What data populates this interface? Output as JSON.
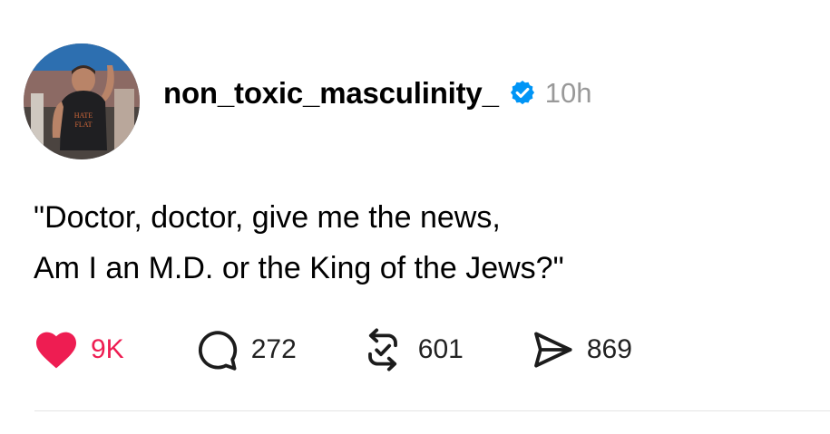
{
  "post": {
    "author": {
      "username": "non_toxic_masculinity_",
      "verified": true,
      "avatar_shirt_text": "HATE\nFLAT"
    },
    "timestamp": "10h",
    "text_lines": [
      "\"Doctor, doctor, give me the news,",
      "Am I an M.D. or the King of the Jews?\""
    ],
    "actions": {
      "likes": "9K",
      "liked": true,
      "replies": "272",
      "reposts": "601",
      "shares": "869"
    }
  },
  "colors": {
    "like_red": "#ee1d52",
    "verified_blue": "#0095f6",
    "timestamp_gray": "#999999"
  },
  "icons": [
    "heart-icon",
    "comment-icon",
    "repost-icon",
    "share-icon",
    "verified-badge-icon"
  ]
}
